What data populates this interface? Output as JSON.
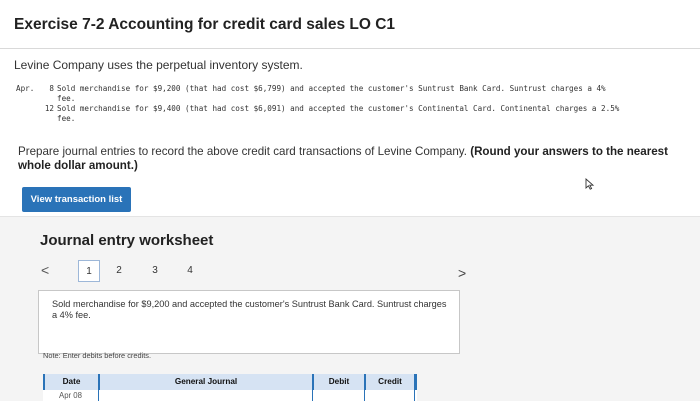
{
  "header": {
    "title": "Exercise 7-2 Accounting for credit card sales LO C1"
  },
  "problem": {
    "intro": "Levine Company uses the perpetual inventory system.",
    "month": "Apr.",
    "transactions": [
      {
        "day": "8",
        "text": "Sold merchandise for $9,200 (that had cost $6,799) and accepted the customer's Suntrust Bank Card. Suntrust charges a 4%",
        "text_cont": "fee."
      },
      {
        "day": "12",
        "text": "Sold merchandise for $9,400 (that had cost $6,091) and accepted the customer's Continental Card. Continental charges a 2.5%",
        "text_cont": "fee."
      }
    ],
    "instructions": "Prepare journal entries to record the above credit card transactions of Levine Company.",
    "instructions_bold": "(Round your answers to the nearest whole dollar amount.)"
  },
  "actions": {
    "view_transactions_label": "View transaction list"
  },
  "worksheet": {
    "title": "Journal entry worksheet",
    "prev_label": "<",
    "next_label": ">",
    "pages": [
      "1",
      "2",
      "3",
      "4"
    ],
    "active_page": "1",
    "description": "Sold merchandise for $9,200 and accepted the customer's Suntrust Bank Card. Suntrust charges a 4% fee.",
    "note": "Note: Enter debits before credits.",
    "columns": {
      "date": "Date",
      "general_journal": "General Journal",
      "debit": "Debit",
      "credit": "Credit"
    },
    "rows": [
      {
        "date": "Apr 08",
        "general_journal": "",
        "debit": "",
        "credit": ""
      }
    ]
  },
  "colors": {
    "accent": "#2a73b8",
    "header_cell": "#d6e3f3",
    "worksheet_bg": "#f4f4f4"
  },
  "icons": {
    "cursor": "mouse-pointer-icon"
  }
}
